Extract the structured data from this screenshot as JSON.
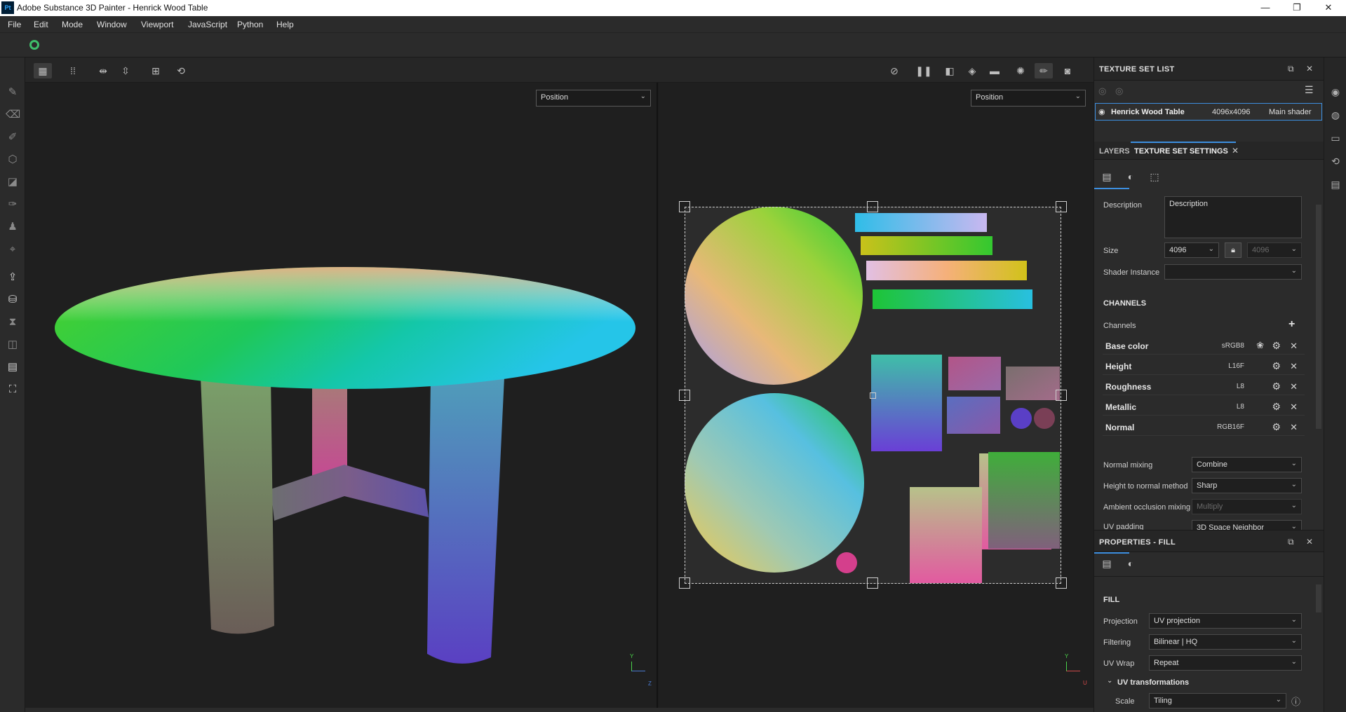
{
  "titlebar": {
    "app_icon": "Pt",
    "title": "Adobe Substance 3D Painter - Henrick Wood Table",
    "minimize": "—",
    "maximize": "❐",
    "close": "✕"
  },
  "menu": [
    "File",
    "Edit",
    "Mode",
    "Window",
    "Viewport",
    "JavaScript",
    "Python",
    "Help"
  ],
  "viewport_3d": {
    "channel_select": "Position",
    "axes": {
      "y": "Y",
      "z": "Z"
    }
  },
  "viewport_2d": {
    "channel_select": "Position",
    "axes": {
      "y": "Y",
      "u": "U"
    }
  },
  "texture_set_list": {
    "title": "TEXTURE SET LIST",
    "row": {
      "name": "Henrick Wood Table",
      "resolution": "4096x4096",
      "shader": "Main shader"
    }
  },
  "tabs": {
    "layers": "LAYERS",
    "texture_set_settings": "TEXTURE SET SETTINGS"
  },
  "texture_set_settings": {
    "description_label": "Description",
    "description_value": "Description",
    "size_label": "Size",
    "size_value": "4096",
    "size_linked_value": "4096",
    "shader_instance_label": "Shader Instance",
    "shader_instance_value": "",
    "channels_heading": "CHANNELS",
    "channels_label": "Channels",
    "channels": [
      {
        "name": "Base color",
        "format": "sRGB8"
      },
      {
        "name": "Height",
        "format": "L16F"
      },
      {
        "name": "Roughness",
        "format": "L8"
      },
      {
        "name": "Metallic",
        "format": "L8"
      },
      {
        "name": "Normal",
        "format": "RGB16F"
      }
    ],
    "normal_mixing_label": "Normal mixing",
    "normal_mixing_value": "Combine",
    "height_to_normal_label": "Height to normal method",
    "height_to_normal_value": "Sharp",
    "ao_mixing_label": "Ambient occlusion mixing",
    "ao_mixing_value": "Multiply",
    "uv_padding_label": "UV padding",
    "uv_padding_value": "3D Space Neighbor"
  },
  "properties_fill": {
    "title": "PROPERTIES - FILL",
    "section": "FILL",
    "projection_label": "Projection",
    "projection_value": "UV projection",
    "filtering_label": "Filtering",
    "filtering_value": "Bilinear | HQ",
    "uv_wrap_label": "UV Wrap",
    "uv_wrap_value": "Repeat",
    "uv_transformations": "UV transformations",
    "scale_label": "Scale",
    "scale_value": "Tiling"
  },
  "colors": {
    "accent": "#3d8fe0",
    "sync": "#3fbf6b",
    "panel": "#2b2b2b",
    "viewport": "#1f1f1f"
  }
}
